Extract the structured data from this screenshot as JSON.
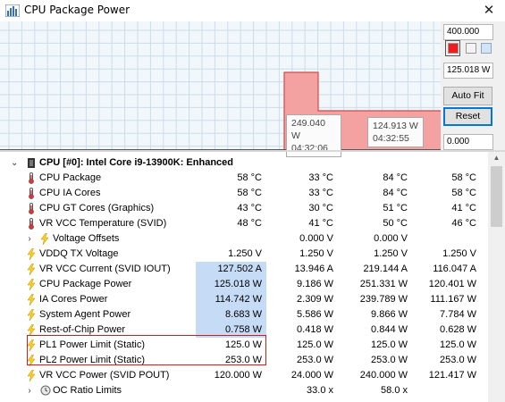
{
  "window": {
    "title": "CPU Package Power",
    "close_glyph": "✕"
  },
  "graph": {
    "tooltip1": {
      "value": "249.040 W",
      "time": "04:32:06"
    },
    "tooltip2": {
      "value": "124.913 W",
      "time": "04:32:55"
    },
    "colors": {
      "grid": "#c9dde9",
      "fill": "#f4a1a1",
      "line": "#d24a4a",
      "background": "#f2f7fb"
    }
  },
  "side_panel": {
    "max_value": "400.000",
    "current_value": "125.018 W",
    "min_value": "0.000",
    "autofit_label": "Auto Fit",
    "reset_label": "Reset"
  },
  "rows": [
    {
      "label": "CPU [#0]: Intel Core i9-13900K: Enhanced",
      "type": "group",
      "expander": "⌄"
    },
    {
      "label": "CPU Package",
      "icon": "thermometer-icon",
      "c1": "58 °C",
      "c2": "33 °C",
      "c3": "84 °C",
      "c4": "58 °C"
    },
    {
      "label": "CPU IA Cores",
      "icon": "thermometer-icon",
      "c1": "58 °C",
      "c2": "33 °C",
      "c3": "84 °C",
      "c4": "58 °C"
    },
    {
      "label": "CPU GT Cores (Graphics)",
      "icon": "thermometer-icon",
      "c1": "43 °C",
      "c2": "30 °C",
      "c3": "51 °C",
      "c4": "41 °C"
    },
    {
      "label": "VR VCC Temperature (SVID)",
      "icon": "thermometer-icon",
      "c1": "48 °C",
      "c2": "41 °C",
      "c3": "50 °C",
      "c4": "46 °C"
    },
    {
      "label": "Voltage Offsets",
      "icon": "lightning-icon",
      "expander": "›",
      "c1": "",
      "c2": "0.000 V",
      "c3": "0.000 V",
      "c4": ""
    },
    {
      "label": "VDDQ TX Voltage",
      "icon": "lightning-icon",
      "c1": "1.250 V",
      "c2": "1.250 V",
      "c3": "1.250 V",
      "c4": "1.250 V"
    },
    {
      "label": "VR VCC Current (SVID IOUT)",
      "icon": "lightning-icon",
      "c1": "127.502 A",
      "c2": "13.946 A",
      "c3": "219.144 A",
      "c4": "116.047 A",
      "highlight": true
    },
    {
      "label": "CPU Package Power",
      "icon": "lightning-icon",
      "c1": "125.018 W",
      "c2": "9.186 W",
      "c3": "251.331 W",
      "c4": "120.401 W",
      "highlight": true
    },
    {
      "label": "IA Cores Power",
      "icon": "lightning-icon",
      "c1": "114.742 W",
      "c2": "2.309 W",
      "c3": "239.789 W",
      "c4": "111.167 W",
      "highlight": true
    },
    {
      "label": "System Agent Power",
      "icon": "lightning-icon",
      "c1": "8.683 W",
      "c2": "5.586 W",
      "c3": "9.866 W",
      "c4": "7.784 W",
      "highlight": true
    },
    {
      "label": "Rest-of-Chip Power",
      "icon": "lightning-icon",
      "c1": "0.758 W",
      "c2": "0.418 W",
      "c3": "0.844 W",
      "c4": "0.628 W",
      "highlight": true
    },
    {
      "label": "PL1 Power Limit (Static)",
      "icon": "lightning-icon",
      "c1": "125.0 W",
      "c2": "125.0 W",
      "c3": "125.0 W",
      "c4": "125.0 W"
    },
    {
      "label": "PL2 Power Limit (Static)",
      "icon": "lightning-icon",
      "c1": "253.0 W",
      "c2": "253.0 W",
      "c3": "253.0 W",
      "c4": "253.0 W"
    },
    {
      "label": "VR VCC Power (SVID POUT)",
      "icon": "lightning-icon",
      "c1": "120.000 W",
      "c2": "24.000 W",
      "c3": "240.000 W",
      "c4": "121.417 W"
    },
    {
      "label": "OC Ratio Limits",
      "icon": "clock-icon",
      "expander": "›",
      "c1": "",
      "c2": "33.0 x",
      "c3": "58.0 x",
      "c4": ""
    }
  ]
}
